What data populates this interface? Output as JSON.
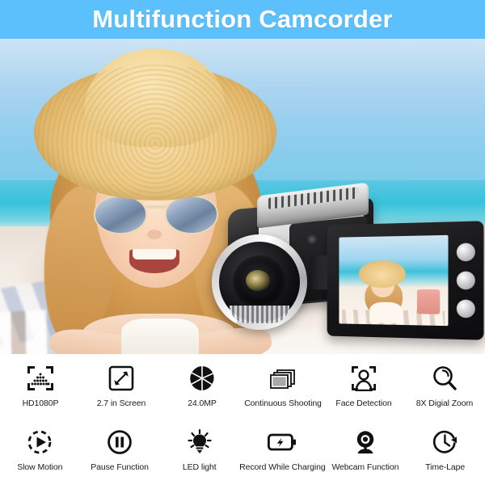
{
  "banner": {
    "title": "Multifunction Camcorder",
    "background_color": "#5bc0fb",
    "text_color": "#ffffff"
  },
  "hero": {
    "alt": "Young girl in straw sun hat and aviator sunglasses lying on a beach towel, with a black and silver camcorder overlaid on the right showing the same scene on its flip-out LCD screen",
    "scene_elements": [
      "blue sky",
      "turquoise sea",
      "white sand",
      "beach towel",
      "pink sandcastle",
      "camcorder"
    ]
  },
  "camcorder": {
    "body_color": "#141416",
    "accent_color": "#e9e9eb",
    "button_count": 3,
    "screen_content": "girl on beach with sandcastle"
  },
  "features": {
    "row1": [
      {
        "icon": "hd-resolution-icon",
        "label": "HD1080P"
      },
      {
        "icon": "screen-size-icon",
        "label": "2.7 in Screen"
      },
      {
        "icon": "aperture-icon",
        "label": "24.0MP"
      },
      {
        "icon": "burst-photos-icon",
        "label": "Continuous Shooting"
      },
      {
        "icon": "face-detection-icon",
        "label": "Face Detection"
      },
      {
        "icon": "magnifier-zoom-icon",
        "label": "8X Digial Zoom"
      }
    ],
    "row2": [
      {
        "icon": "slow-motion-play-icon",
        "label": "Slow Motion"
      },
      {
        "icon": "pause-circle-icon",
        "label": "Pause Function"
      },
      {
        "icon": "lightbulb-icon",
        "label": "LED light"
      },
      {
        "icon": "battery-charging-icon",
        "label": "Record While Charging"
      },
      {
        "icon": "webcam-icon",
        "label": "Webcam Function"
      },
      {
        "icon": "time-lapse-clock-icon",
        "label": "Time-Lape"
      }
    ]
  }
}
